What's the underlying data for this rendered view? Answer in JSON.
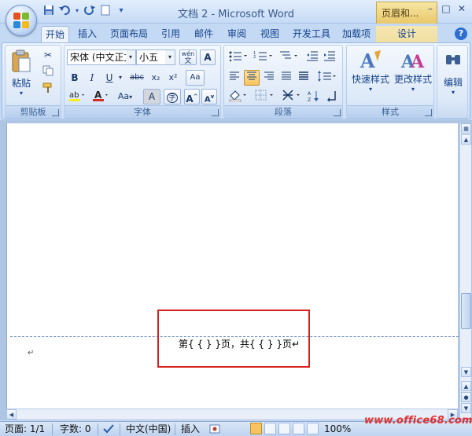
{
  "window": {
    "title": "文档 2 - Microsoft Word",
    "context_tab_header": "页眉和...",
    "buttons": [
      "–",
      "□",
      "✕"
    ]
  },
  "quick_access": [
    "save-icon",
    "undo-icon",
    "redo-icon",
    "new-doc-icon",
    "customize-icon"
  ],
  "tabs": [
    {
      "label": "开始",
      "active": true
    },
    {
      "label": "插入"
    },
    {
      "label": "页面布局"
    },
    {
      "label": "引用"
    },
    {
      "label": "邮件"
    },
    {
      "label": "审阅"
    },
    {
      "label": "视图"
    },
    {
      "label": "开发工具"
    },
    {
      "label": "加载项"
    },
    {
      "label": "设计",
      "contextual": true
    }
  ],
  "help": "?",
  "ribbon": {
    "clipboard": {
      "label": "剪贴板",
      "paste": "粘贴"
    },
    "font": {
      "label": "字体",
      "font_name": "宋体 (中文正文",
      "font_size": "小五",
      "wen_icon": "wén",
      "a_box": "A",
      "bold": "B",
      "italic": "I",
      "underline": "U",
      "strike": "abc",
      "sub": "x₂",
      "sup": "x²",
      "clear": "Aa",
      "font_color": "A",
      "change_case": "Aa",
      "char_shading": "A",
      "enclose": "字",
      "grow": "A",
      "shrink": "A"
    },
    "paragraph": {
      "label": "段落"
    },
    "styles": {
      "label": "样式",
      "quick": "快速样式",
      "change": "更改样式"
    },
    "editing": {
      "label": "编辑"
    }
  },
  "document": {
    "footer_text": "第{ { } }页，共{ { } }页↵",
    "para_mark": "↵"
  },
  "statusbar": {
    "page": "页面: 1/1",
    "words": "字数: 0",
    "language": "中文(中国)",
    "mode": "插入",
    "zoom": "100%"
  },
  "watermark": "www.office68.com",
  "colors": {
    "accent": "#15428b",
    "highlight_box": "#d8211f",
    "active_button": "#f7c45f"
  }
}
